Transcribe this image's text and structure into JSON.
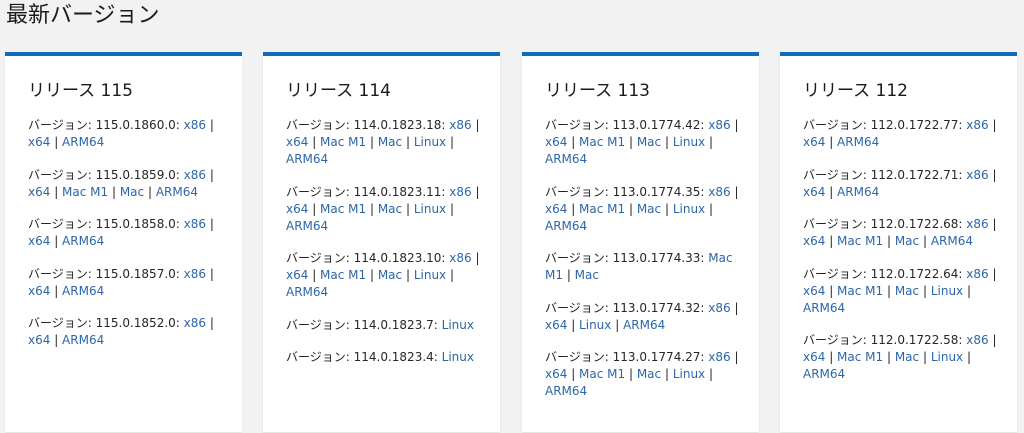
{
  "page_title": "最新バージョン",
  "releases": [
    {
      "title": "リリース 115",
      "entries": [
        {
          "label": "バージョン: 115.0.1860.0:",
          "links": [
            "x86",
            "x64",
            "ARM64"
          ]
        },
        {
          "label": "バージョン: 115.0.1859.0:",
          "links": [
            "x86",
            "x64",
            "Mac M1",
            "Mac",
            "ARM64"
          ]
        },
        {
          "label": "バージョン: 115.0.1858.0:",
          "links": [
            "x86",
            "x64",
            "ARM64"
          ]
        },
        {
          "label": "バージョン: 115.0.1857.0:",
          "links": [
            "x86",
            "x64",
            "ARM64"
          ]
        },
        {
          "label": "バージョン: 115.0.1852.0:",
          "links": [
            "x86",
            "x64",
            "ARM64"
          ]
        }
      ]
    },
    {
      "title": "リリース 114",
      "entries": [
        {
          "label": "バージョン: 114.0.1823.18:",
          "links": [
            "x86",
            "x64",
            "Mac M1",
            "Mac",
            "Linux",
            "ARM64"
          ]
        },
        {
          "label": "バージョン: 114.0.1823.11:",
          "links": [
            "x86",
            "x64",
            "Mac M1",
            "Mac",
            "Linux",
            "ARM64"
          ]
        },
        {
          "label": "バージョン: 114.0.1823.10:",
          "links": [
            "x86",
            "x64",
            "Mac M1",
            "Mac",
            "Linux",
            "ARM64"
          ]
        },
        {
          "label": "バージョン: 114.0.1823.7:",
          "links": [
            "Linux"
          ]
        },
        {
          "label": "バージョン: 114.0.1823.4:",
          "links": [
            "Linux"
          ]
        }
      ]
    },
    {
      "title": "リリース 113",
      "entries": [
        {
          "label": "バージョン: 113.0.1774.42:",
          "links": [
            "x86",
            "x64",
            "Mac M1",
            "Mac",
            "Linux",
            "ARM64"
          ]
        },
        {
          "label": "バージョン: 113.0.1774.35:",
          "links": [
            "x86",
            "x64",
            "Mac M1",
            "Mac",
            "Linux",
            "ARM64"
          ]
        },
        {
          "label": "バージョン: 113.0.1774.33:",
          "links": [
            "Mac M1",
            "Mac"
          ]
        },
        {
          "label": "バージョン: 113.0.1774.32:",
          "links": [
            "x86",
            "x64",
            "Linux",
            "ARM64"
          ]
        },
        {
          "label": "バージョン: 113.0.1774.27:",
          "links": [
            "x86",
            "x64",
            "Mac M1",
            "Mac",
            "Linux",
            "ARM64"
          ]
        }
      ]
    },
    {
      "title": "リリース 112",
      "entries": [
        {
          "label": "バージョン: 112.0.1722.77:",
          "links": [
            "x86",
            "x64",
            "ARM64"
          ]
        },
        {
          "label": "バージョン: 112.0.1722.71:",
          "links": [
            "x86",
            "x64",
            "ARM64"
          ]
        },
        {
          "label": "バージョン: 112.0.1722.68:",
          "links": [
            "x86",
            "x64",
            "Mac M1",
            "Mac",
            "ARM64"
          ]
        },
        {
          "label": "バージョン: 112.0.1722.64:",
          "links": [
            "x86",
            "x64",
            "Mac M1",
            "Mac",
            "Linux",
            "ARM64"
          ]
        },
        {
          "label": "バージョン: 112.0.1722.58:",
          "links": [
            "x86",
            "x64",
            "Mac M1",
            "Mac",
            "Linux",
            "ARM64"
          ]
        }
      ]
    }
  ],
  "colors": {
    "accent": "#0f6cbd",
    "link": "#2d66a8",
    "background": "#f2f2f2"
  }
}
